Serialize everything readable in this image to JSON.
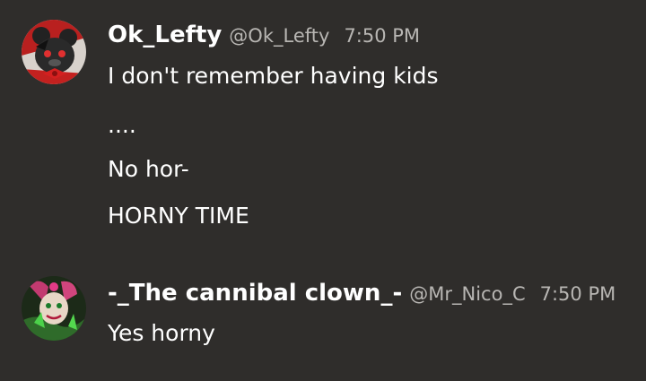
{
  "messages": [
    {
      "display_name": "Ok_Lefty",
      "handle": "@Ok_Lefty",
      "time": "7:50 PM",
      "avatar": "black-bear-avatar-icon",
      "lines": [
        "I don't remember having kids",
        "....",
        "No hor-",
        "HORNY TIME"
      ]
    },
    {
      "display_name": "-_The cannibal clown_-",
      "handle": "@Mr_Nico_C",
      "time": "7:50 PM",
      "avatar": "clown-avatar-icon",
      "lines": [
        "Yes horny"
      ]
    }
  ],
  "colors": {
    "background": "#2f2d2b",
    "text": "#ffffff",
    "meta_text": "#b8b6b3"
  }
}
